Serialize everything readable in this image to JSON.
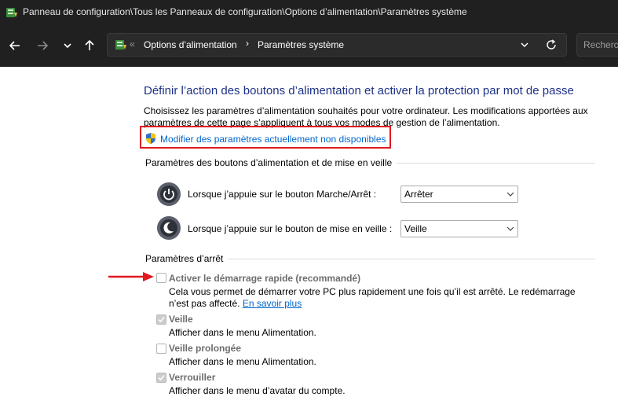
{
  "titlebar": {
    "title": "Panneau de configuration\\Tous les Panneaux de configuration\\Options d’alimentation\\Paramètres système",
    "app_icon": "control-panel-icon"
  },
  "navbar": {
    "back_icon": "arrow-left-icon",
    "forward_icon": "arrow-right-icon",
    "recent_icon": "chevron-down-icon",
    "up_icon": "arrow-up-icon",
    "address": {
      "crumbs": [
        "Options d’alimentation",
        "Paramètres système"
      ],
      "overflow_glyph": "«",
      "separator": "›"
    },
    "search_placeholder": "Rechercher"
  },
  "main": {
    "heading": "Définir l’action des boutons d’alimentation et activer la protection par mot de passe",
    "description": "Choisissez les paramètres d’alimentation souhaités pour votre ordinateur. Les modifications apportées aux paramètres de cette page s’appliquent à tous vos modes de gestion de l’alimentation.",
    "modify_link": "Modifier des paramètres actuellement non disponibles",
    "highlight_color": "#e1191f",
    "link_color": "#0066cc",
    "heading_color": "#1e3287"
  },
  "power_buttons": {
    "group_title": "Paramètres des boutons d’alimentation et de mise en veille",
    "rows": [
      {
        "label": "Lorsque j’appuie sur le bouton Marche/Arrêt :",
        "value": "Arrêter",
        "icon": "power-icon"
      },
      {
        "label": "Lorsque j’appuie sur le bouton de mise en veille :",
        "value": "Veille",
        "icon": "sleep-icon"
      }
    ]
  },
  "shutdown": {
    "group_title": "Paramètres d’arrêt",
    "options": [
      {
        "title": "Activer le démarrage rapide (recommandé)",
        "desc": "Cela vous permet de démarrer votre PC plus rapidement une fois qu’il est arrêté. Le redémarrage n’est pas affecté.",
        "link": "En savoir plus",
        "checked": false
      },
      {
        "title": "Veille",
        "desc": "Afficher dans le menu Alimentation.",
        "checked": true
      },
      {
        "title": "Veille prolongée",
        "desc": "Afficher dans le menu Alimentation.",
        "checked": false
      },
      {
        "title": "Verrouiller",
        "desc": "Afficher dans le menu d’avatar du compte.",
        "checked": true
      }
    ]
  }
}
